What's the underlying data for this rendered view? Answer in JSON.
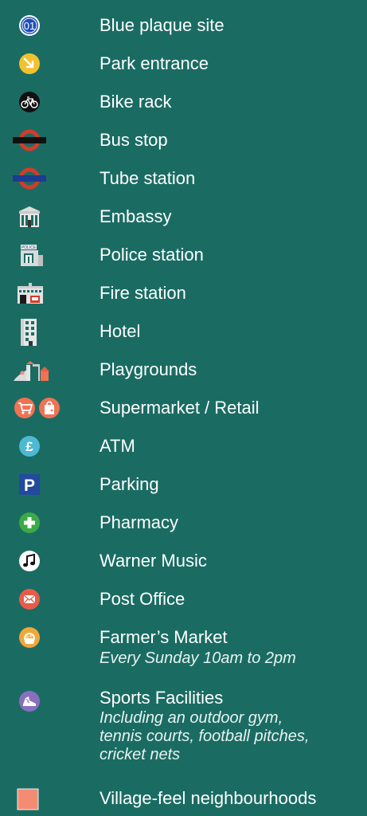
{
  "legend": {
    "items": [
      {
        "icon": "blue-plaque-icon",
        "label": "Blue plaque site",
        "badge": "01"
      },
      {
        "icon": "park-entrance-icon",
        "label": "Park entrance"
      },
      {
        "icon": "bike-icon",
        "label": "Bike rack"
      },
      {
        "icon": "bus-roundel-icon",
        "label": "Bus stop"
      },
      {
        "icon": "tube-roundel-icon",
        "label": "Tube station"
      },
      {
        "icon": "embassy-building-icon",
        "label": "Embassy"
      },
      {
        "icon": "police-building-icon",
        "label": "Police station",
        "sign": "POLICE"
      },
      {
        "icon": "fire-station-building-icon",
        "label": "Fire station"
      },
      {
        "icon": "hotel-building-icon",
        "label": "Hotel"
      },
      {
        "icon": "playground-icon",
        "label": "Playgrounds"
      },
      {
        "icon": "shopping-cart-icon",
        "icon2": "shopping-bag-icon",
        "label": "Supermarket / Retail"
      },
      {
        "icon": "pound-sign-icon",
        "label": "ATM",
        "glyph": "£"
      },
      {
        "icon": "parking-icon",
        "label": "Parking",
        "glyph": "P"
      },
      {
        "icon": "pharmacy-cross-icon",
        "label": "Pharmacy"
      },
      {
        "icon": "music-note-icon",
        "label": "Warner Music"
      },
      {
        "icon": "envelope-icon",
        "label": "Post Office"
      },
      {
        "icon": "market-basket-icon",
        "label": "Farmer’s Market",
        "note_lines": [
          "Every Sunday 10am to 2pm"
        ]
      },
      {
        "icon": "sports-shoe-icon",
        "label": "Sports Facilities",
        "note_lines": [
          "Including an outdoor gym,",
          "tennis courts, football pitches,",
          "cricket nets"
        ]
      },
      {
        "icon": "neighbourhood-swatch-icon",
        "label": "Village-feel neighbourhoods"
      }
    ]
  },
  "colors": {
    "background": "#1a6c63",
    "plaque_blue": "#1e4fb8",
    "park_yellow": "#f2c12e",
    "roundel_red": "#d8392b",
    "tube_blue": "#1d3b8f",
    "retail_coral": "#f07253",
    "atm_cyan": "#4dbad3",
    "parking_blue": "#234a9c",
    "pharmacy_green": "#3caa46",
    "post_red": "#e95b48",
    "market_orange": "#f0a73a",
    "sports_purple": "#8a6fbf",
    "village_salmon": "#f48c74"
  }
}
